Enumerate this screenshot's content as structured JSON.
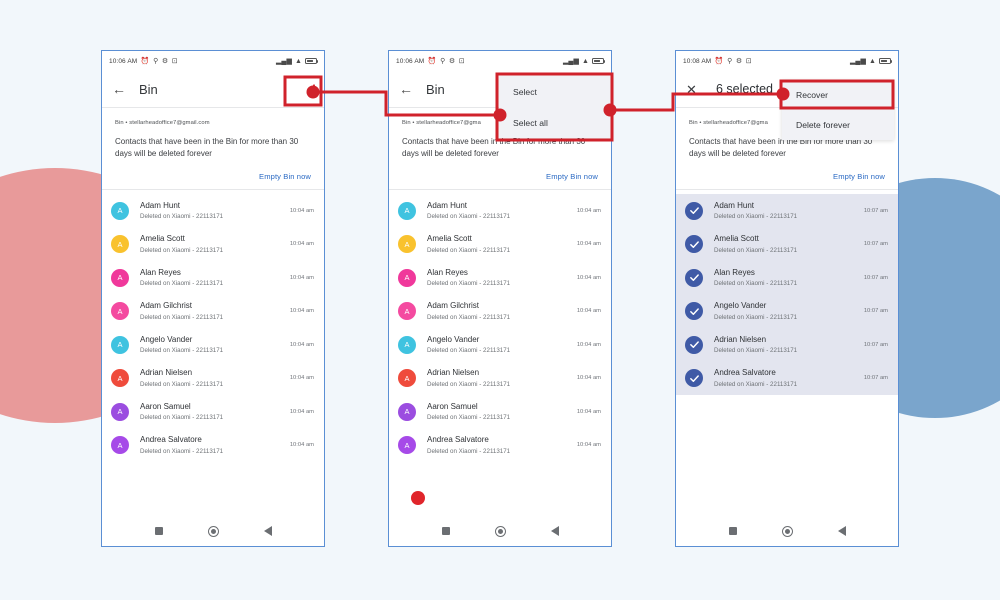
{
  "screen": {
    "background_color": "#f2f7fb",
    "accent_red": "#d0222b",
    "blob_left_color": "#e89a9a",
    "blob_right_color": "#7aa5cc"
  },
  "common": {
    "account_line": "Bin • stellarheadoffice7@gmail.com",
    "account_line_truncated": "Bin • stellarheadoffice7@gma",
    "note": "Contacts that have been in the Bin for more than 30 days will be deleted forever",
    "empty_bin_label": "Empty Bin now",
    "deleted_sub": "Deleted on Xiaomi - 22113171",
    "back_icon": "←",
    "close_icon": "✕",
    "kebab_icon": "overflow-menu-icon",
    "nav_recents_icon": "square-recents-icon",
    "nav_home_icon": "circle-home-icon",
    "nav_back_icon": "triangle-back-icon",
    "status_icons": [
      "alarm-icon",
      "location-icon",
      "gear-icon",
      "screenshot-icon"
    ],
    "signal_icon": "signal-bars-icon",
    "wifi_icon": "wifi-icon",
    "battery_icon": "battery-icon"
  },
  "phone1": {
    "status_time": "10:06 AM",
    "title": "Bin",
    "contacts": [
      {
        "name": "Adam Hunt",
        "initial": "A",
        "color": "#3fc3e0",
        "time": "10:04 am"
      },
      {
        "name": "Amelia Scott",
        "initial": "A",
        "color": "#f9c22e",
        "time": "10:04 am"
      },
      {
        "name": "Alan Reyes",
        "initial": "A",
        "color": "#f0389b",
        "time": "10:04 am"
      },
      {
        "name": "Adam Gilchrist",
        "initial": "A",
        "color": "#f44aa0",
        "time": "10:04 am"
      },
      {
        "name": "Angelo Vander",
        "initial": "A",
        "color": "#3fc3e0",
        "time": "10:04 am"
      },
      {
        "name": "Adrian Nielsen",
        "initial": "A",
        "color": "#ef4b3c",
        "time": "10:04 am"
      },
      {
        "name": "Aaron Samuel",
        "initial": "A",
        "color": "#9b4de0",
        "time": "10:04 am"
      },
      {
        "name": "Andrea Salvatore",
        "initial": "A",
        "color": "#a64ae8",
        "time": "10:04 am"
      }
    ]
  },
  "phone2": {
    "status_time": "10:06 AM",
    "title": "Bin",
    "menu": {
      "items": [
        "Select",
        "Select all"
      ]
    },
    "contacts": [
      {
        "name": "Adam Hunt",
        "initial": "A",
        "color": "#3fc3e0",
        "time": "10:04 am"
      },
      {
        "name": "Amelia Scott",
        "initial": "A",
        "color": "#f9c22e",
        "time": "10:04 am"
      },
      {
        "name": "Alan Reyes",
        "initial": "A",
        "color": "#f0389b",
        "time": "10:04 am"
      },
      {
        "name": "Adam Gilchrist",
        "initial": "A",
        "color": "#f44aa0",
        "time": "10:04 am"
      },
      {
        "name": "Angelo Vander",
        "initial": "A",
        "color": "#3fc3e0",
        "time": "10:04 am"
      },
      {
        "name": "Adrian Nielsen",
        "initial": "A",
        "color": "#ef4b3c",
        "time": "10:04 am"
      },
      {
        "name": "Aaron Samuel",
        "initial": "A",
        "color": "#9b4de0",
        "time": "10:04 am"
      },
      {
        "name": "Andrea Salvatore",
        "initial": "A",
        "color": "#a64ae8",
        "time": "10:04 am"
      }
    ]
  },
  "phone3": {
    "status_time": "10:08 AM",
    "title": "6 selected",
    "menu": {
      "items": [
        "Recover",
        "Delete forever"
      ]
    },
    "contacts": [
      {
        "name": "Adam Hunt",
        "time": "10:07 am",
        "selected": true
      },
      {
        "name": "Amelia Scott",
        "time": "10:07 am",
        "selected": true
      },
      {
        "name": "Alan Reyes",
        "time": "10:07 am",
        "selected": true
      },
      {
        "name": "Angelo Vander",
        "time": "10:07 am",
        "selected": true
      },
      {
        "name": "Adrian Nielsen",
        "time": "10:07 am",
        "selected": true
      },
      {
        "name": "Andrea Salvatore",
        "time": "10:07 am",
        "selected": true
      }
    ]
  }
}
